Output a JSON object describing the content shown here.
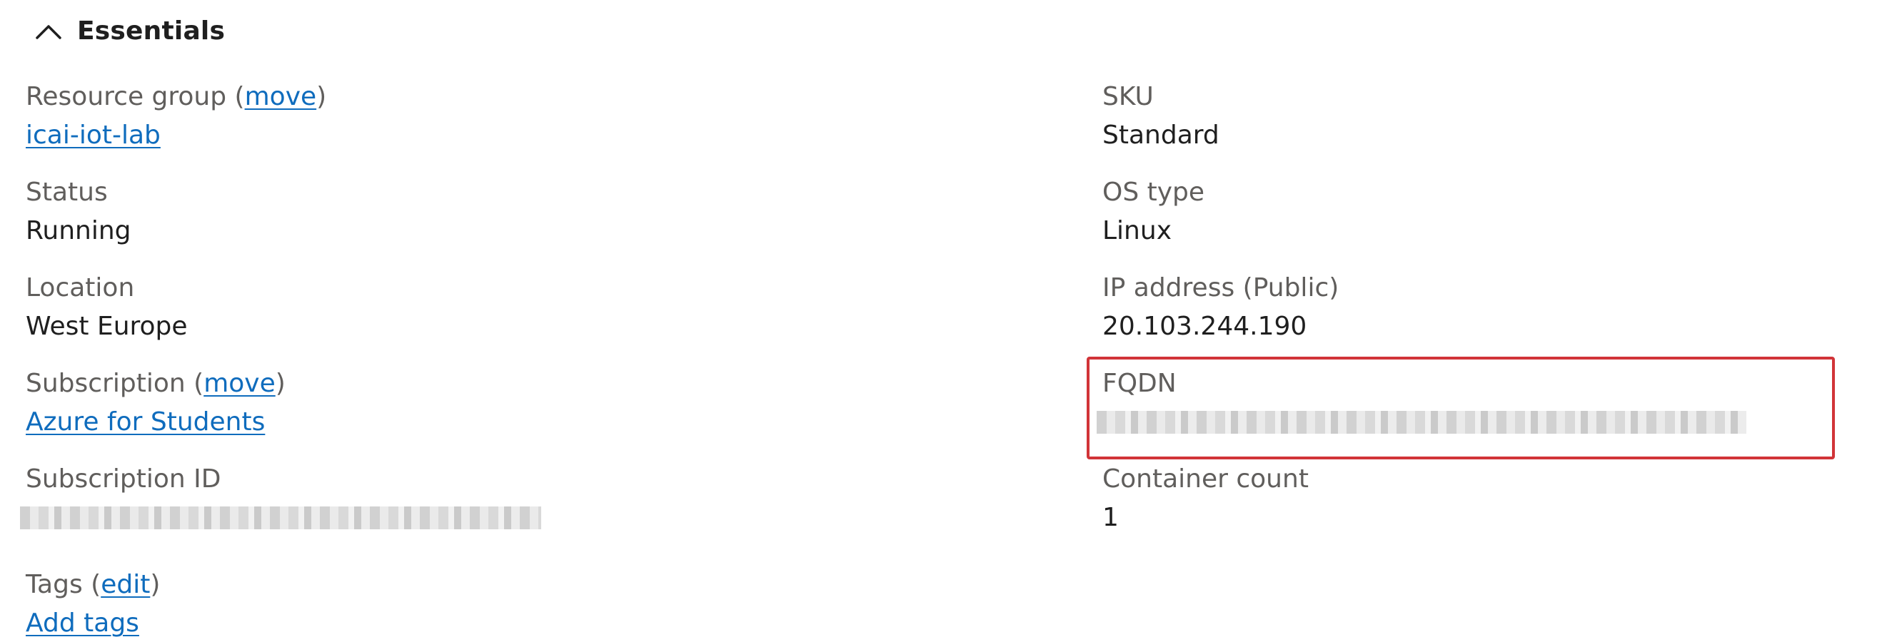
{
  "header": {
    "title": "Essentials",
    "icon": "chevron-up-icon"
  },
  "left": {
    "resource_group": {
      "label": "Resource group",
      "action": "move",
      "value": "icai-iot-lab"
    },
    "status": {
      "label": "Status",
      "value": "Running"
    },
    "location": {
      "label": "Location",
      "value": "West Europe"
    },
    "subscription": {
      "label": "Subscription",
      "action": "move",
      "value": "Azure for Students"
    },
    "subscription_id": {
      "label": "Subscription ID"
    },
    "tags": {
      "label": "Tags",
      "action": "edit",
      "value": "Add tags"
    }
  },
  "right": {
    "sku": {
      "label": "SKU",
      "value": "Standard"
    },
    "os_type": {
      "label": "OS type",
      "value": "Linux"
    },
    "ip_address": {
      "label": "IP address (Public)",
      "value": "20.103.244.190"
    },
    "fqdn": {
      "label": "FQDN"
    },
    "container_count": {
      "label": "Container count",
      "value": "1"
    }
  },
  "colors": {
    "link": "#0f6cbd",
    "label": "#605e5c",
    "value": "#1f1f1f",
    "highlight": "#d13438"
  }
}
